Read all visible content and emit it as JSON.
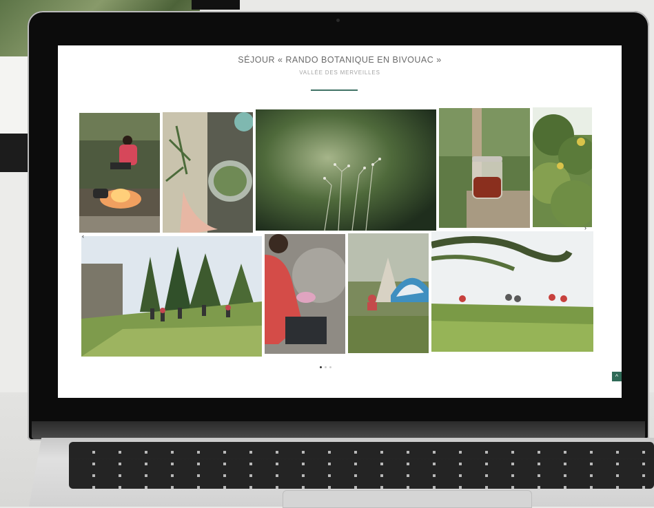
{
  "page": {
    "title": "SÉJOUR « RANDO BOTANIQUE EN BIVOUAC »",
    "subtitle": "VALLÉE DES MERVEILLES",
    "accent_color": "#3f7265"
  },
  "gallery": {
    "photos": [
      {
        "name": "photo-woman-cooking-fire",
        "description_icon": "campfire-photo"
      },
      {
        "name": "photo-hands-herbs-bowl",
        "description_icon": "herbs-photo"
      },
      {
        "name": "photo-wildflowers-closeup",
        "description_icon": "flower-photo"
      },
      {
        "name": "photo-jar-of-honey",
        "description_icon": "jar-photo"
      },
      {
        "name": "photo-green-bushes",
        "description_icon": "foliage-photo"
      },
      {
        "name": "photo-hikers-group-trail",
        "description_icon": "hikers-photo"
      },
      {
        "name": "photo-woman-red-sweater",
        "description_icon": "person-photo"
      },
      {
        "name": "photo-tents-bivouac",
        "description_icon": "tent-photo"
      },
      {
        "name": "photo-hikers-sitting-meadow",
        "description_icon": "meadow-photo"
      }
    ],
    "next_arrow": "›",
    "prev_arrow": "‹",
    "pagination": {
      "total": 3,
      "active": 1
    }
  },
  "controls": {
    "scroll_top_icon": "^",
    "scroll_top_color": "#2f6a57"
  }
}
